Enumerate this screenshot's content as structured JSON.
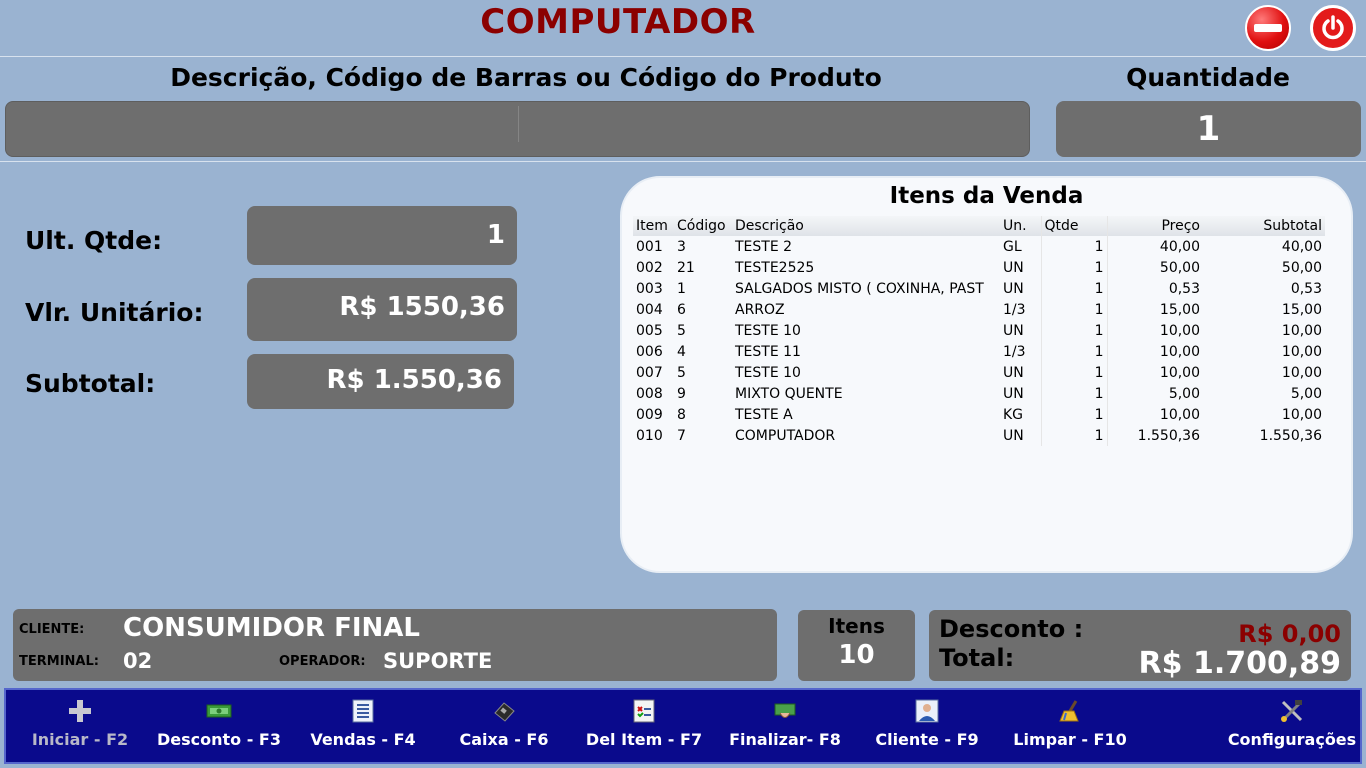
{
  "header": {
    "title": "COMPUTADOR"
  },
  "search": {
    "label": "Descrição, Código de Barras ou Código do Produto",
    "value": ""
  },
  "quantity": {
    "label": "Quantidade",
    "value": "1"
  },
  "info": {
    "ult_qtde_label": "Ult. Qtde:",
    "ult_qtde_value": "1",
    "vlr_unitario_label": "Vlr. Unitário:",
    "vlr_unitario_value": "R$ 1550,36",
    "subtotal_label": "Subtotal:",
    "subtotal_value": "R$ 1.550,36"
  },
  "items_panel": {
    "title": "Itens da Venda",
    "columns": [
      "Item",
      "Código",
      "Descrição",
      "Un.",
      "Qtde",
      "Preço",
      "Subtotal"
    ],
    "rows": [
      [
        "001",
        "3",
        "TESTE 2",
        "GL",
        "1",
        "40,00",
        "40,00"
      ],
      [
        "002",
        "21",
        "TESTE2525",
        "UN",
        "1",
        "50,00",
        "50,00"
      ],
      [
        "003",
        "1",
        "SALGADOS MISTO ( COXINHA, PAST",
        "UN",
        "1",
        "0,53",
        "0,53"
      ],
      [
        "004",
        "6",
        "ARROZ",
        "1/3",
        "1",
        "15,00",
        "15,00"
      ],
      [
        "005",
        "5",
        "TESTE 10",
        "UN",
        "1",
        "10,00",
        "10,00"
      ],
      [
        "006",
        "4",
        "TESTE 11",
        "1/3",
        "1",
        "10,00",
        "10,00"
      ],
      [
        "007",
        "5",
        "TESTE 10",
        "UN",
        "1",
        "10,00",
        "10,00"
      ],
      [
        "008",
        "9",
        "MIXTO QUENTE",
        "UN",
        "1",
        "5,00",
        "5,00"
      ],
      [
        "009",
        "8",
        "TESTE A",
        "KG",
        "1",
        "10,00",
        "10,00"
      ],
      [
        "010",
        "7",
        "COMPUTADOR",
        "UN",
        "1",
        "1.550,36",
        "1.550,36"
      ]
    ]
  },
  "client": {
    "cliente_label": "CLIENTE:",
    "cliente_value": "CONSUMIDOR FINAL",
    "terminal_label": "TERMINAL:",
    "terminal_value": "02",
    "operador_label": "OPERADOR:",
    "operador_value": "SUPORTE"
  },
  "summary": {
    "itens_label": "Itens",
    "itens_value": "10",
    "desconto_label": "Desconto :",
    "desconto_value": "R$ 0,00",
    "total_label": "Total:",
    "total_value": "R$ 1.700,89"
  },
  "toolbar": {
    "iniciar": "Iniciar - F2",
    "desconto": "Desconto - F3",
    "vendas": "Vendas - F4",
    "caixa": "Caixa - F6",
    "del_item": "Del Item - F7",
    "finalizar": "Finalizar- F8",
    "cliente": "Cliente - F9",
    "limpar": "Limpar - F10",
    "configuracoes": "Configurações"
  },
  "colors": {
    "background": "#9ab3d1",
    "title": "#8b0000",
    "field": "#6e6e6e",
    "toolbar": "#0a0a8c"
  },
  "icons": [
    "minus-circle-icon",
    "power-icon",
    "plus-icon",
    "money-icon",
    "list-icon",
    "cash-register-icon",
    "delete-item-icon",
    "finalize-icon",
    "client-icon",
    "broom-icon",
    "tools-icon"
  ]
}
